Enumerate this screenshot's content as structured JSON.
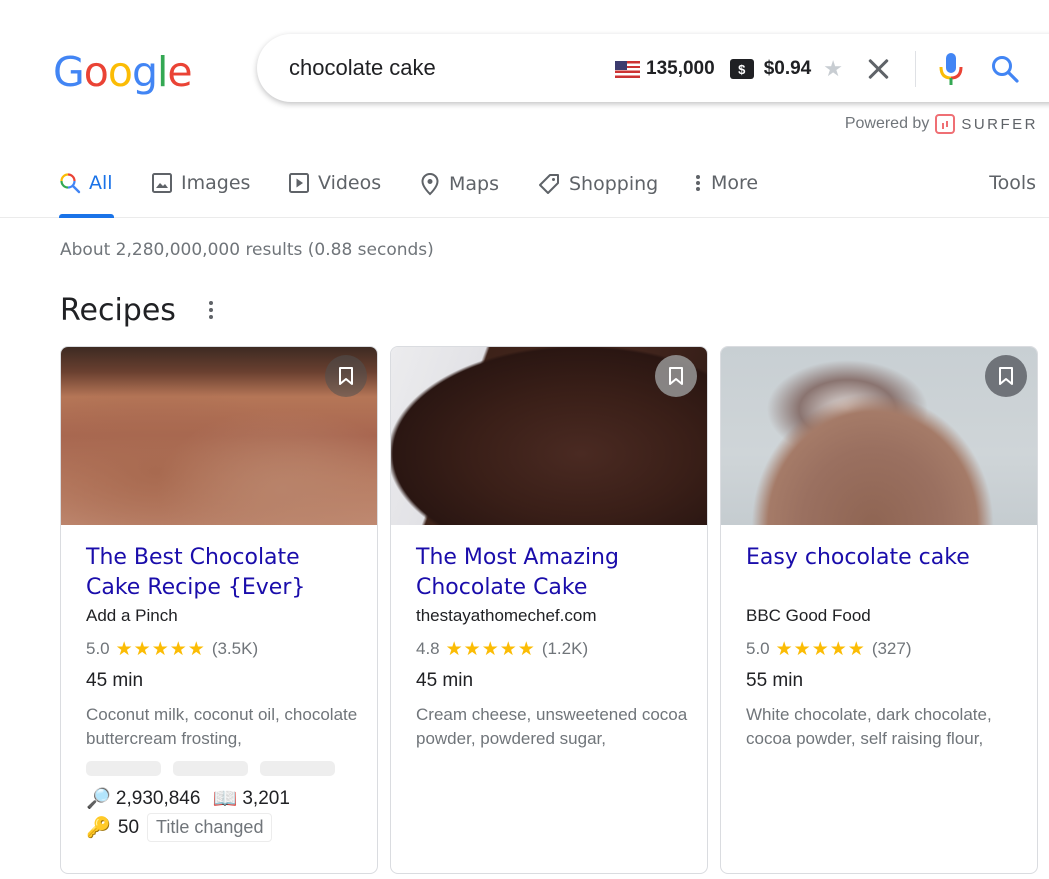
{
  "header": {
    "logo": [
      "G",
      "o",
      "o",
      "g",
      "l",
      "e"
    ],
    "logo_colors": [
      "#4285f4",
      "#ea4335",
      "#fbbc05",
      "#4285f4",
      "#34a853",
      "#ea4335"
    ],
    "search_query": "chocolate cake",
    "search_volume": "135,000",
    "cpc_badge": "$",
    "cpc": "$0.94",
    "powered_by": "Powered by",
    "powered_brand": "SURFER"
  },
  "tabs": {
    "items": [
      {
        "label": "All",
        "icon": "search-icon",
        "active": true
      },
      {
        "label": "Images",
        "icon": "image-icon"
      },
      {
        "label": "Videos",
        "icon": "play-icon"
      },
      {
        "label": "Maps",
        "icon": "map-pin-icon"
      },
      {
        "label": "Shopping",
        "icon": "tag-icon"
      },
      {
        "label": "More",
        "icon": "more-vert-icon"
      }
    ],
    "tools": "Tools"
  },
  "result_stats": "About 2,280,000,000 results (0.88 seconds)",
  "recipes": {
    "title": "Recipes",
    "cards": [
      {
        "title": "The Best Chocolate Cake Recipe {Ever}",
        "source": "Add a Pinch",
        "rating": "5.0",
        "stars": "★★★★★",
        "reviews": "(3.5K)",
        "time": "45 min",
        "ingredients": "Coconut milk, coconut oil, chocolate buttercream frosting,",
        "searches": "2,930,846",
        "pages": "3,201",
        "keywords": "50",
        "status_tag": "Title changed"
      },
      {
        "title": "The Most Amazing Chocolate Cake",
        "source": "thestayathomechef.com",
        "rating": "4.8",
        "stars": "★★★★★",
        "reviews": "(1.2K)",
        "time": "45 min",
        "ingredients": "Cream cheese, unsweetened cocoa powder, powdered sugar,"
      },
      {
        "title": "Easy chocolate cake",
        "source": "BBC Good Food",
        "rating": "5.0",
        "stars": "★★★★★",
        "reviews": "(327)",
        "time": "55 min",
        "ingredients": "White chocolate, dark chocolate, cocoa powder, self raising flour,"
      }
    ]
  },
  "colors": {
    "link": "#1a0dab",
    "accent": "#1a73e8",
    "star": "#fbbc04",
    "surfer": "#ef6f74"
  }
}
